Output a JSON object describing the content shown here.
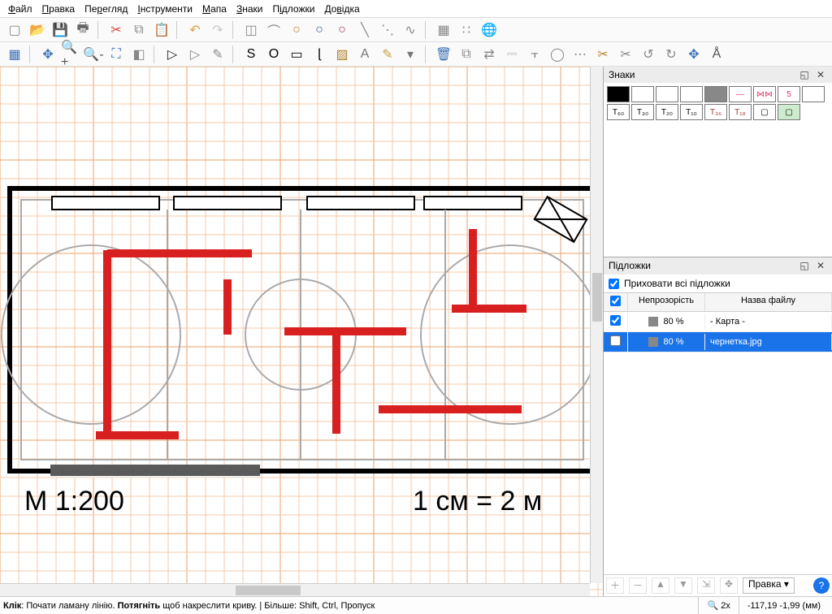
{
  "menu": {
    "items": [
      {
        "label": "Файл",
        "u": 0
      },
      {
        "label": "Правка",
        "u": 0
      },
      {
        "label": "Перегляд",
        "u": 2
      },
      {
        "label": "Інструменти",
        "u": 0
      },
      {
        "label": "Мапа",
        "u": 0
      },
      {
        "label": "Знаки",
        "u": 0
      },
      {
        "label": "Підложки",
        "u": 1
      },
      {
        "label": "Довідка",
        "u": 2
      }
    ]
  },
  "toolbar1": [
    {
      "name": "new-file-icon",
      "g": "▢",
      "c": "#888"
    },
    {
      "name": "open-file-icon",
      "g": "📂",
      "c": "#d9a24a"
    },
    {
      "name": "save-icon",
      "g": "💾",
      "c": "#3b6fb5"
    },
    {
      "name": "print-icon",
      "g": "🖶",
      "c": "#666"
    },
    {
      "name": "sep"
    },
    {
      "name": "cut-icon",
      "g": "✂",
      "c": "#d04030"
    },
    {
      "name": "copy-icon",
      "g": "⧉",
      "c": "#888"
    },
    {
      "name": "paste-icon",
      "g": "📋",
      "c": "#b48a52"
    },
    {
      "name": "sep"
    },
    {
      "name": "undo-icon",
      "g": "↶",
      "c": "#d9a24a"
    },
    {
      "name": "redo-icon",
      "g": "↷",
      "c": "#c9c9c9"
    },
    {
      "name": "sep"
    },
    {
      "name": "select-icon",
      "g": "◫",
      "c": "#888"
    },
    {
      "name": "lasso-icon",
      "g": "⌒",
      "c": "#888"
    },
    {
      "name": "circle1-icon",
      "g": "○",
      "c": "#c08030"
    },
    {
      "name": "circle2-icon",
      "g": "○",
      "c": "#3060a0"
    },
    {
      "name": "circle3-icon",
      "g": "○",
      "c": "#a03060"
    },
    {
      "name": "line-tool-icon",
      "g": "╲",
      "c": "#888"
    },
    {
      "name": "dot-line-icon",
      "g": "⋱",
      "c": "#888"
    },
    {
      "name": "curve-tool-icon",
      "g": "∿",
      "c": "#888"
    },
    {
      "name": "sep"
    },
    {
      "name": "grid-snap-icon",
      "g": "▦",
      "c": "#888"
    },
    {
      "name": "dots-icon",
      "g": "∷",
      "c": "#888"
    },
    {
      "name": "globe-icon",
      "g": "🌐",
      "c": "#5a7"
    }
  ],
  "toolbar2": [
    {
      "name": "grid-toggle-icon",
      "g": "▦",
      "c": "#3b6fb5"
    },
    {
      "name": "sep"
    },
    {
      "name": "move-icon",
      "g": "✥",
      "c": "#3b6fb5"
    },
    {
      "name": "zoom-in-icon",
      "g": "🔍+",
      "c": "#555"
    },
    {
      "name": "zoom-out-icon",
      "g": "🔍-",
      "c": "#555"
    },
    {
      "name": "fit-icon",
      "g": "⛶",
      "c": "#3b6fb5"
    },
    {
      "name": "layers-icon",
      "g": "◧",
      "c": "#888"
    },
    {
      "name": "sep"
    },
    {
      "name": "pointer-icon",
      "g": "▷",
      "c": "#222"
    },
    {
      "name": "node-edit-icon",
      "g": "▷",
      "c": "#888"
    },
    {
      "name": "pen-icon",
      "g": "✎",
      "c": "#888"
    },
    {
      "name": "sep"
    },
    {
      "name": "s-curve-icon",
      "g": "S",
      "c": "#000"
    },
    {
      "name": "ellipse-icon",
      "g": "O",
      "c": "#000"
    },
    {
      "name": "rect-icon",
      "g": "▭",
      "c": "#000"
    },
    {
      "name": "freehand-icon",
      "g": "ɭ",
      "c": "#000"
    },
    {
      "name": "fill-icon",
      "g": "▨",
      "c": "#b08030"
    },
    {
      "name": "text-icon",
      "g": "A",
      "c": "#777"
    },
    {
      "name": "pencil-icon",
      "g": "✎",
      "c": "#c9a040"
    },
    {
      "name": "dropdown-icon",
      "g": "▾",
      "c": "#777"
    },
    {
      "name": "sep"
    },
    {
      "name": "trash-icon",
      "g": "🗑",
      "c": "#3b6fb5"
    },
    {
      "name": "duplicate-icon",
      "g": "⧉",
      "c": "#888"
    },
    {
      "name": "swap-icon",
      "g": "⇄",
      "c": "#888"
    },
    {
      "name": "align-icon",
      "g": "⎓",
      "c": "#888"
    },
    {
      "name": "join-icon",
      "g": "⫟",
      "c": "#888"
    },
    {
      "name": "ring-icon",
      "g": "◯",
      "c": "#888"
    },
    {
      "name": "dots2-icon",
      "g": "⋯",
      "c": "#888"
    },
    {
      "name": "cut2-icon",
      "g": "✂",
      "c": "#c08030"
    },
    {
      "name": "cut3-icon",
      "g": "✂",
      "c": "#888"
    },
    {
      "name": "rotate-ccw-icon",
      "g": "↺",
      "c": "#888"
    },
    {
      "name": "rotate-cw-icon",
      "g": "↻",
      "c": "#888"
    },
    {
      "name": "center-icon",
      "g": "✥",
      "c": "#3b6fb5"
    },
    {
      "name": "compass-icon",
      "g": "Å",
      "c": "#555"
    }
  ],
  "panels": {
    "symbols": {
      "title": "Знаки",
      "items": [
        {
          "name": "sym-black",
          "bg": "#000",
          "label": ""
        },
        {
          "name": "sym-white1",
          "bg": "#fff",
          "label": ""
        },
        {
          "name": "sym-white2",
          "bg": "#fff",
          "label": ""
        },
        {
          "name": "sym-white3",
          "bg": "#fff",
          "label": ""
        },
        {
          "name": "sym-grey",
          "bg": "#888",
          "label": ""
        },
        {
          "name": "sym-pink-line",
          "bg": "#fff",
          "label": "—",
          "color": "#e36"
        },
        {
          "name": "sym-chain",
          "bg": "#fff",
          "label": "⋈⋈",
          "color": "#e36"
        },
        {
          "name": "sym-five",
          "bg": "#fff",
          "label": "5",
          "color": "#e36"
        },
        {
          "name": "sym-blank",
          "bg": "#fff",
          "label": ""
        },
        {
          "name": "sym-t60",
          "bg": "#fff",
          "label": "T₆₀"
        },
        {
          "name": "sym-t30",
          "bg": "#fff",
          "label": "T₃₀"
        },
        {
          "name": "sym-t20",
          "bg": "#fff",
          "label": "T₂₀"
        },
        {
          "name": "sym-t10",
          "bg": "#fff",
          "label": "T₁₀"
        },
        {
          "name": "sym-t36",
          "bg": "#fff",
          "label": "T₃₆",
          "color": "#a33"
        },
        {
          "name": "sym-t18",
          "bg": "#fff",
          "label": "T₁₈",
          "color": "#a33"
        },
        {
          "name": "sym-box1",
          "bg": "#fff",
          "label": "▢"
        },
        {
          "name": "sym-box2",
          "bg": "#cdeccd",
          "label": "▢"
        }
      ]
    },
    "templates": {
      "title": "Підложки",
      "hide_all": "Приховати всі підложки",
      "hide_checked": true,
      "head": {
        "opacity": "Непрозорість",
        "name": "Назва файлу"
      },
      "rows": [
        {
          "checked": true,
          "opacity": "80 %",
          "name": "- Карта -",
          "selected": false
        },
        {
          "checked": false,
          "opacity": "80 %",
          "name": "чернетка.jpg",
          "selected": true
        }
      ],
      "edit_btn": "Правка"
    }
  },
  "status": {
    "hint_b1": "Клік",
    "hint_t1": ": Почати ламану лінію. ",
    "hint_b2": "Потягніть",
    "hint_t2": " щоб накреслити криву. | Більше: Shift, Ctrl, Пропуск",
    "zoom_icon": "🔍",
    "zoom": "2x",
    "coords": "-117,19 -1,99 (мм)"
  },
  "drawing": {
    "scale_left": "М 1:200",
    "scale_right": "1 см = 2 м"
  }
}
